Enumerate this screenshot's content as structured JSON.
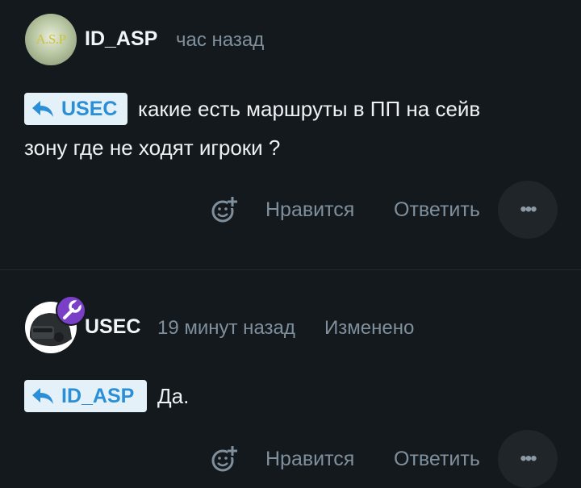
{
  "comments": [
    {
      "author": "ID_ASP",
      "time": "час назад",
      "avatar_text": "A.S.P",
      "reply_to": "USEC",
      "text_line1": "какие есть маршруты в ПП на сейв",
      "text_line2": "зону где не ходят игроки ?",
      "like_label": "Нравится",
      "reply_label": "Ответить",
      "more_glyph": "•••"
    },
    {
      "author": "USEC",
      "time": "19 минут назад",
      "edited": "Изменено",
      "reply_to": "ID_ASP",
      "text_line1": "Да.",
      "like_label": "Нравится",
      "reply_label": "Ответить",
      "more_glyph": "•••"
    }
  ],
  "colors": {
    "background": "#14191d",
    "chip_background": "#e4f1f8",
    "chip_text": "#2a8fd6",
    "meta_text": "#7f8f9c",
    "badge": "#7a3fc7"
  },
  "icons": {
    "reply_arrow": "reply-arrow-icon",
    "add_reaction": "add-reaction-icon",
    "more": "more-icon",
    "moderator_badge": "wrench-icon"
  }
}
